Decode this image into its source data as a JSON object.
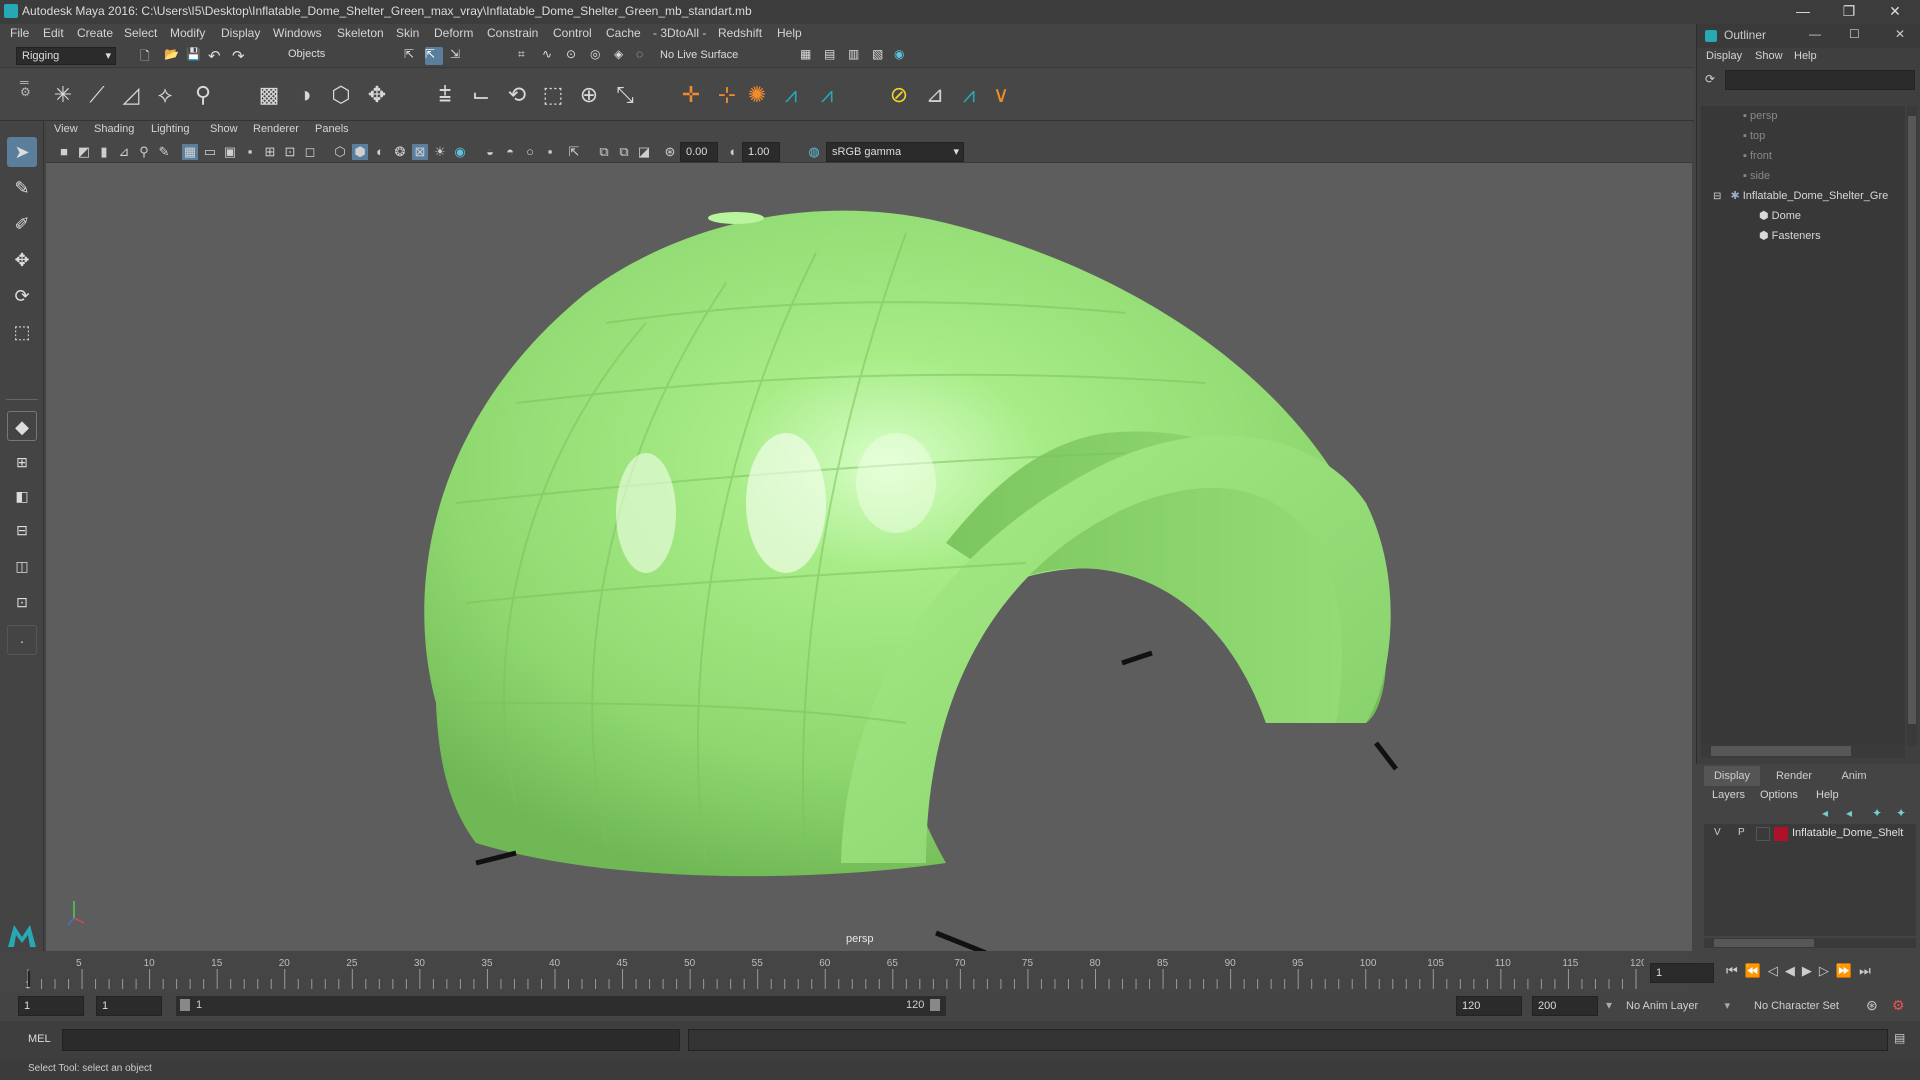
{
  "window": {
    "title": "Autodesk Maya 2016: C:\\Users\\I5\\Desktop\\Inflatable_Dome_Shelter_Green_max_vray\\Inflatable_Dome_Shelter_Green_mb_standart.mb",
    "minimize": "—",
    "maximize": "❐",
    "close": "✕"
  },
  "menus": [
    "File",
    "Edit",
    "Create",
    "Select",
    "Modify",
    "Display",
    "Windows",
    "Skeleton",
    "Skin",
    "Deform",
    "Constrain",
    "Control",
    "Cache",
    "- 3DtoAll -",
    "Redshift",
    "Help"
  ],
  "status": {
    "menuset": "Rigging",
    "selection_mode": "Objects",
    "live_surface": "No Live Surface"
  },
  "viewport": {
    "menus": [
      "View",
      "Shading",
      "Lighting",
      "Show",
      "Renderer",
      "Panels"
    ],
    "exposure": "0.00",
    "gamma": "1.00",
    "color_space": "sRGB gamma",
    "camera_label": "persp"
  },
  "outliner": {
    "title": "Outliner",
    "menus": [
      "Display",
      "Show",
      "Help"
    ],
    "items": [
      {
        "label": "persp",
        "dim": true,
        "indent": 0
      },
      {
        "label": "top",
        "dim": true,
        "indent": 0
      },
      {
        "label": "front",
        "dim": true,
        "indent": 0
      },
      {
        "label": "side",
        "dim": true,
        "indent": 0
      },
      {
        "label": "Inflatable_Dome_Shelter_Gre",
        "dim": false,
        "indent": 0
      },
      {
        "label": "Dome",
        "dim": false,
        "indent": 1
      },
      {
        "label": "Fasteners",
        "dim": false,
        "indent": 1
      }
    ]
  },
  "layers": {
    "tabs": [
      "Display",
      "Render",
      "Anim"
    ],
    "menus": [
      "Layers",
      "Options",
      "Help"
    ],
    "row": {
      "v": "V",
      "p": "P",
      "name": "Inflatable_Dome_Shelt",
      "color": "#b0102a"
    }
  },
  "timeline": {
    "ticks": [
      "1",
      "5",
      "10",
      "15",
      "20",
      "25",
      "30",
      "35",
      "40",
      "45",
      "50",
      "55",
      "60",
      "65",
      "70",
      "75",
      "80",
      "85",
      "90",
      "95",
      "100",
      "105",
      "110",
      "115",
      "120"
    ],
    "current_frame": "1"
  },
  "range": {
    "start": "1",
    "playback_start": "1",
    "slider_start": "1",
    "slider_end": "120",
    "playback_end": "120",
    "end": "200",
    "anim_layer": "No Anim Layer",
    "char_set": "No Character Set"
  },
  "cmd": {
    "label": "MEL"
  },
  "help": {
    "text": "Select Tool: select an object"
  },
  "colors": {
    "dome": "#93de74",
    "accent": "#5dc1e0",
    "maya_teal": "#27a9b5"
  }
}
